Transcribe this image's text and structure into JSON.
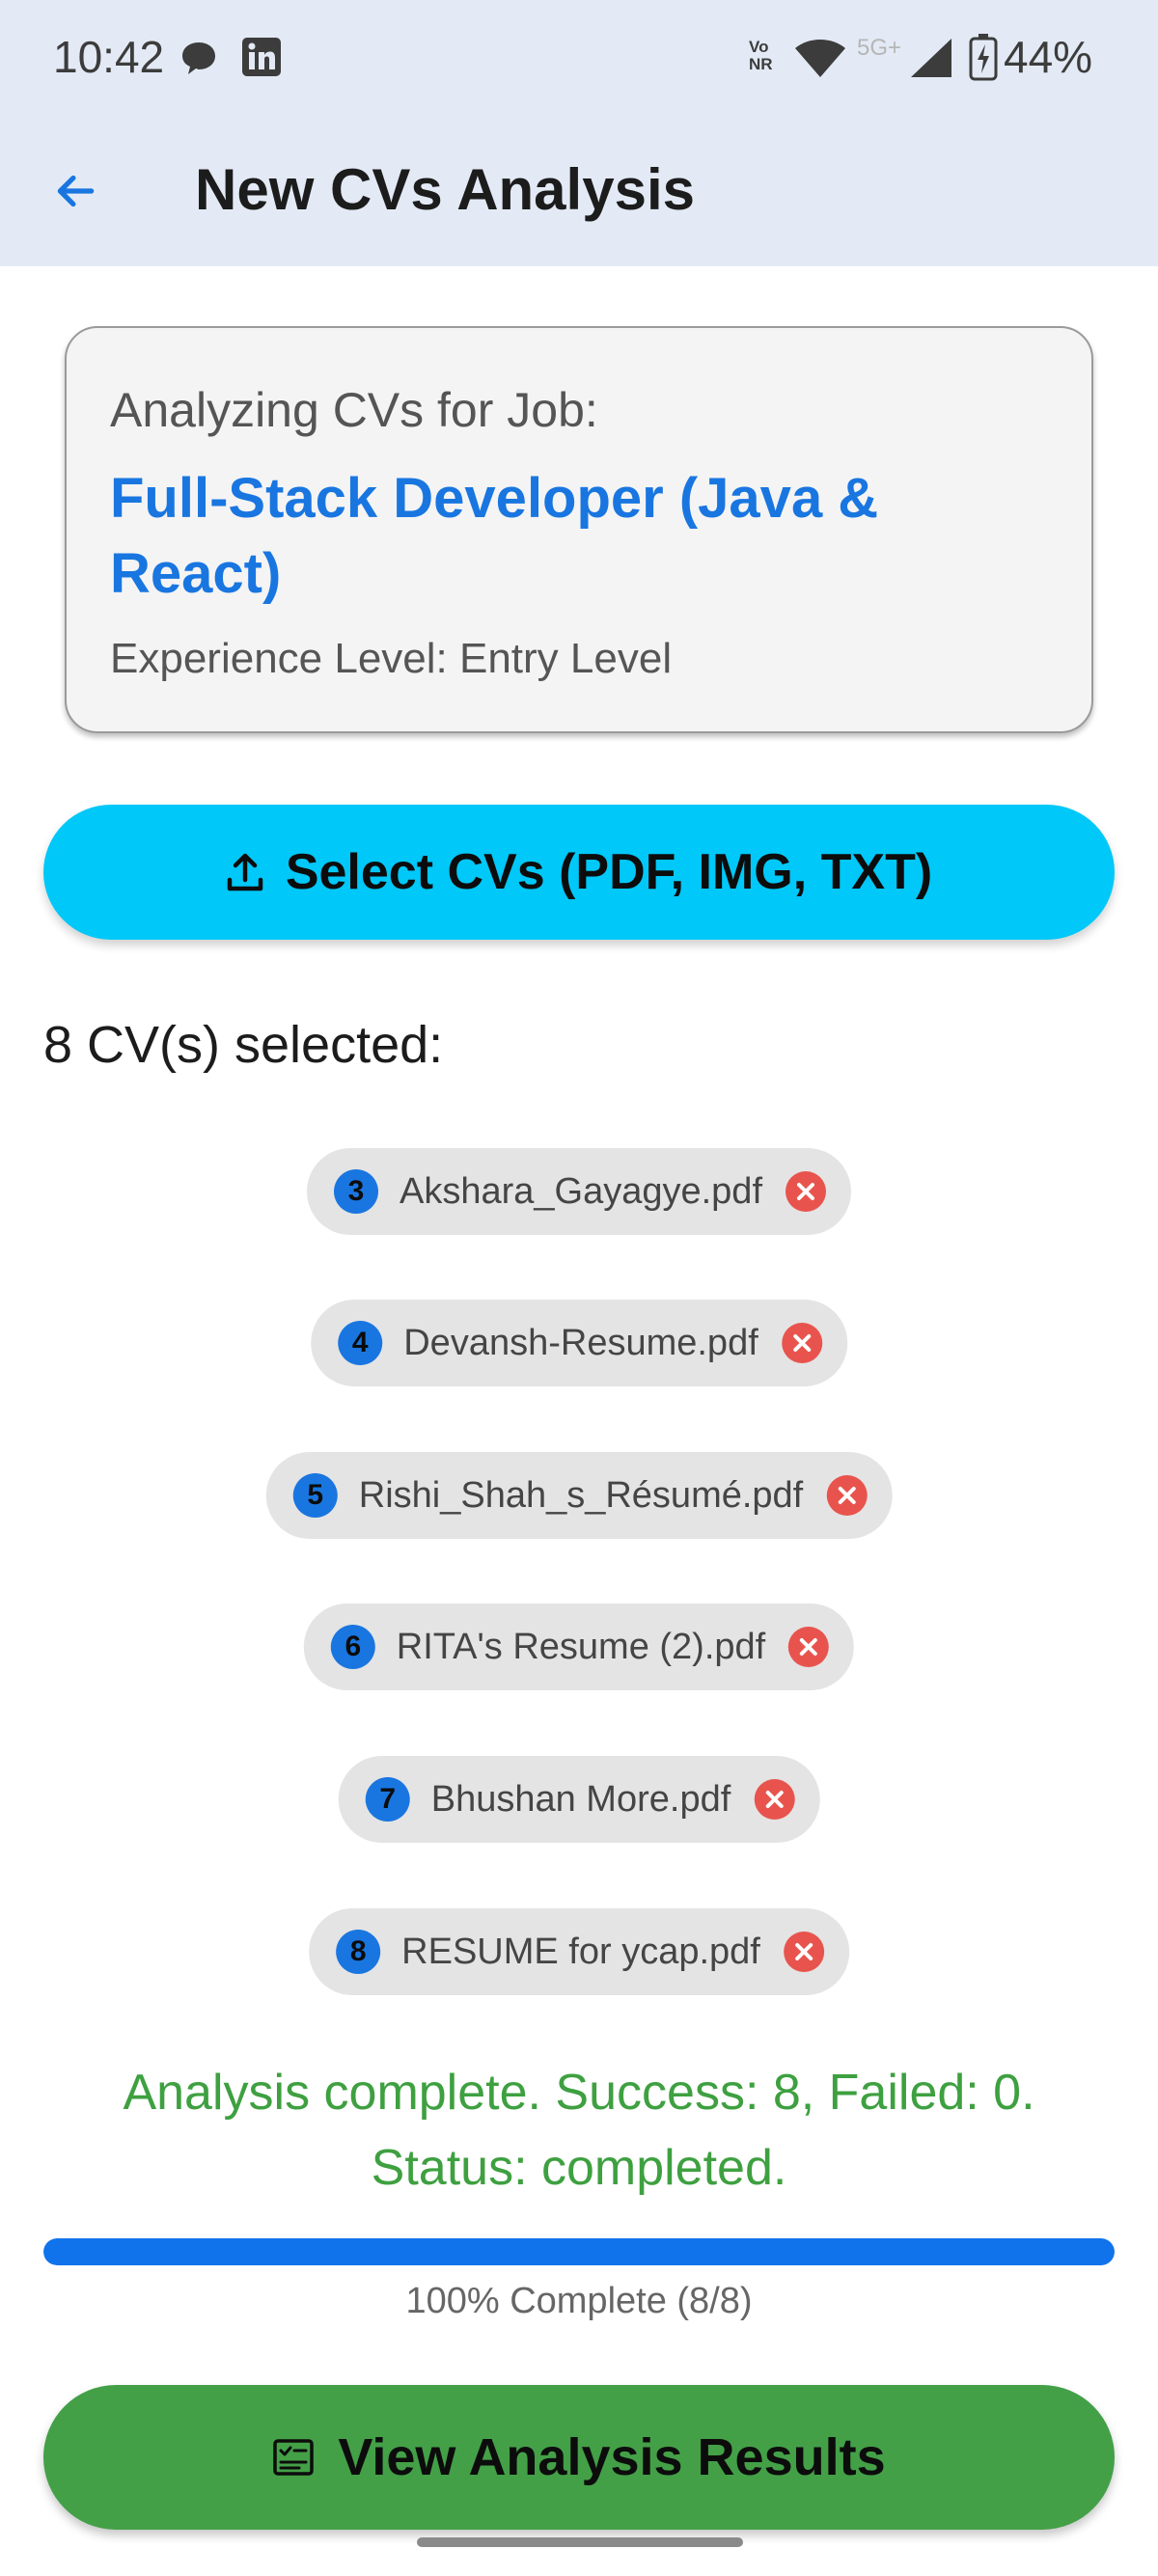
{
  "status_bar": {
    "time": "10:42",
    "network_label": "Vo NR",
    "network_type": "5G+",
    "battery": "44%",
    "icons": [
      "chat-icon",
      "linkedin-icon",
      "wifi-icon",
      "signal-icon",
      "battery-charging-icon"
    ]
  },
  "app_bar": {
    "title": "New CVs Analysis",
    "back_icon": "arrow-left-icon"
  },
  "job_card": {
    "heading": "Analyzing CVs for Job:",
    "job_title": "Full-Stack Developer (Java & React)",
    "experience": "Experience Level: Entry Level"
  },
  "select_button": {
    "label": "Select CVs (PDF, IMG, TXT)",
    "icon": "upload-icon"
  },
  "selected_count": "8 CV(s) selected:",
  "files": [
    {
      "number": "3",
      "name": "Akshara_Gayagye.pdf"
    },
    {
      "number": "4",
      "name": "Devansh-Resume.pdf"
    },
    {
      "number": "5",
      "name": "Rishi_Shah_s_Résumé.pdf"
    },
    {
      "number": "6",
      "name": "RITA's Resume (2).pdf"
    },
    {
      "number": "7",
      "name": "Bhushan More.pdf"
    },
    {
      "number": "8",
      "name": "RESUME for ycap.pdf"
    }
  ],
  "analysis": {
    "status_text": "Analysis complete. Success: 8, Failed: 0. Status: completed.",
    "progress_fraction": 1.0,
    "progress_text": "100% Complete (8/8)"
  },
  "results_button": {
    "label": "View Analysis Results",
    "icon": "analysis-report-icon"
  },
  "colors": {
    "accent_blue": "#1976e0",
    "select_button": "#00c8f8",
    "success_green": "#43a047",
    "remove_red": "#e8544d",
    "header_bg": "#e3eaf5"
  }
}
